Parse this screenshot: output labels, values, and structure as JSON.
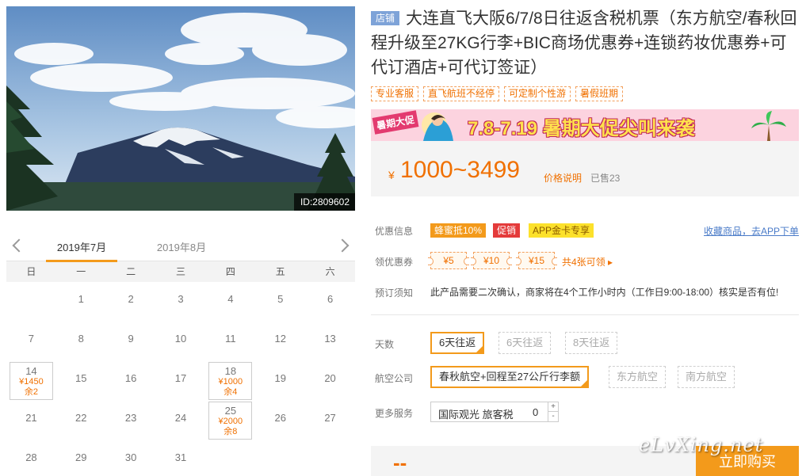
{
  "hero": {
    "image_id": "ID:2809602"
  },
  "calendar": {
    "months": [
      "2019年7月",
      "2019年8月"
    ],
    "weekdays": [
      "日",
      "一",
      "二",
      "三",
      "四",
      "五",
      "六"
    ],
    "weeks": [
      [
        {
          "d": ""
        },
        {
          "d": "1"
        },
        {
          "d": "2"
        },
        {
          "d": "3"
        },
        {
          "d": "4"
        },
        {
          "d": "5"
        },
        {
          "d": "6"
        }
      ],
      [
        {
          "d": "7"
        },
        {
          "d": "8"
        },
        {
          "d": "9"
        },
        {
          "d": "10"
        },
        {
          "d": "11"
        },
        {
          "d": "12"
        },
        {
          "d": "13"
        }
      ],
      [
        {
          "d": "14",
          "price": "¥1450",
          "stock": "余2"
        },
        {
          "d": "15"
        },
        {
          "d": "16"
        },
        {
          "d": "17"
        },
        {
          "d": "18",
          "price": "¥1000",
          "stock": "余4"
        },
        {
          "d": "19"
        },
        {
          "d": "20"
        }
      ],
      [
        {
          "d": "21"
        },
        {
          "d": "22"
        },
        {
          "d": "23"
        },
        {
          "d": "24"
        },
        {
          "d": "25",
          "price": "¥2000",
          "stock": "余8"
        },
        {
          "d": "26"
        },
        {
          "d": "27"
        }
      ],
      [
        {
          "d": "28"
        },
        {
          "d": "29"
        },
        {
          "d": "30"
        },
        {
          "d": "31"
        },
        {
          "d": ""
        },
        {
          "d": ""
        },
        {
          "d": ""
        }
      ]
    ]
  },
  "product": {
    "shop_badge": "店铺",
    "title": "大连直飞大阪6/7/8日往返含税机票（东方航空/春秋回程升级至27KG行李+BIC商场优惠券+连锁药妆优惠券+可代订酒店+可代订签证）",
    "tags": [
      "专业客服",
      "直飞航班不经停",
      "可定制个性游",
      "暑假班期"
    ]
  },
  "banner": {
    "corner_tag": "暑期大促",
    "text": "7.8-7.19 暑期大促尖叫来袭"
  },
  "price": {
    "currency": "¥",
    "range": "1000~3499",
    "note": "价格说明",
    "sold": "已售23"
  },
  "promo": {
    "label": "优惠信息",
    "chips": [
      "蜂蜜抵10%",
      "促销",
      "APP金卡专享"
    ],
    "fav_link": "收藏商品，去APP下单"
  },
  "coupons": {
    "label": "领优惠券",
    "items": [
      "¥5",
      "¥10",
      "¥15"
    ],
    "more": "共4张可领 ▸"
  },
  "booking_notice": {
    "label": "预订须知",
    "text": "此产品需要二次确认，商家将在4个工作小时内（工作日9:00-18:00）核实是否有位!"
  },
  "options": {
    "days_label": "天数",
    "days": [
      "6天往返",
      "6天往返",
      "8天往返"
    ],
    "airline_label": "航空公司",
    "airlines": [
      "春秋航空+回程至27公斤行李额",
      "东方航空",
      "南方航空"
    ],
    "service_label": "更多服务",
    "service_name": "国际观光 旅客税",
    "service_qty": "0",
    "plus": "+",
    "minus": "-"
  },
  "bottom": {
    "dash": "--",
    "buy": "立即购买",
    "watermark": "eLvXing.net"
  }
}
